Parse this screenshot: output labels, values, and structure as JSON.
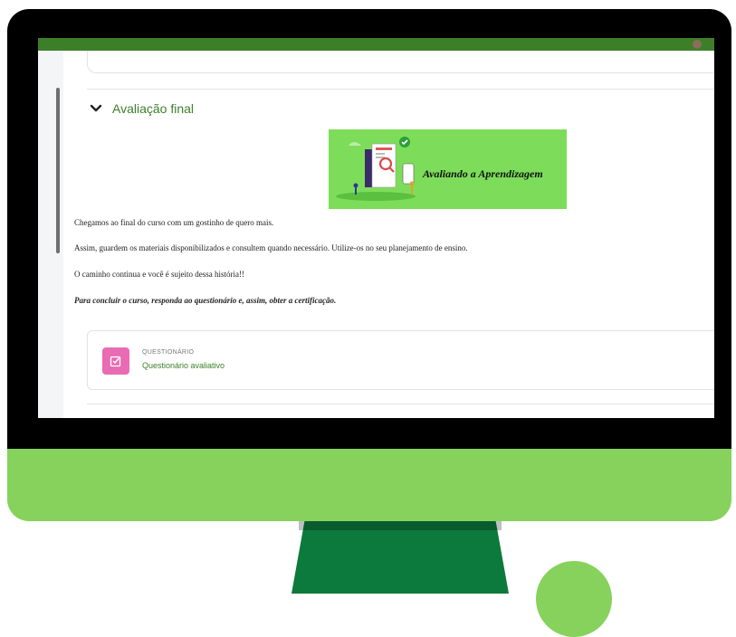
{
  "section": {
    "title": "Avaliação final",
    "banner_text": "Avaliando a Aprendizagem",
    "paragraphs": [
      "Chegamos ao final do curso com um gostinho de quero mais.",
      "Assim, guardem os materiais disponibilizados e consultem quando necessário. Utilize-os no seu planejamento de ensino.",
      "O caminho continua e você é sujeito dessa história!!",
      "Para concluir o curso, responda ao questionário e, assim, obter a certificação."
    ]
  },
  "activity": {
    "type_label": "QUESTIONÁRIO",
    "name": "Questionário avaliativo"
  },
  "colors": {
    "topbar": "#3d7f29",
    "link_green": "#3d7f29",
    "banner_bg": "#7ddd5a",
    "quiz_icon_bg": "#e96bb3",
    "monitor_chin": "#86d25c",
    "monitor_stand": "#0b7a3c"
  }
}
